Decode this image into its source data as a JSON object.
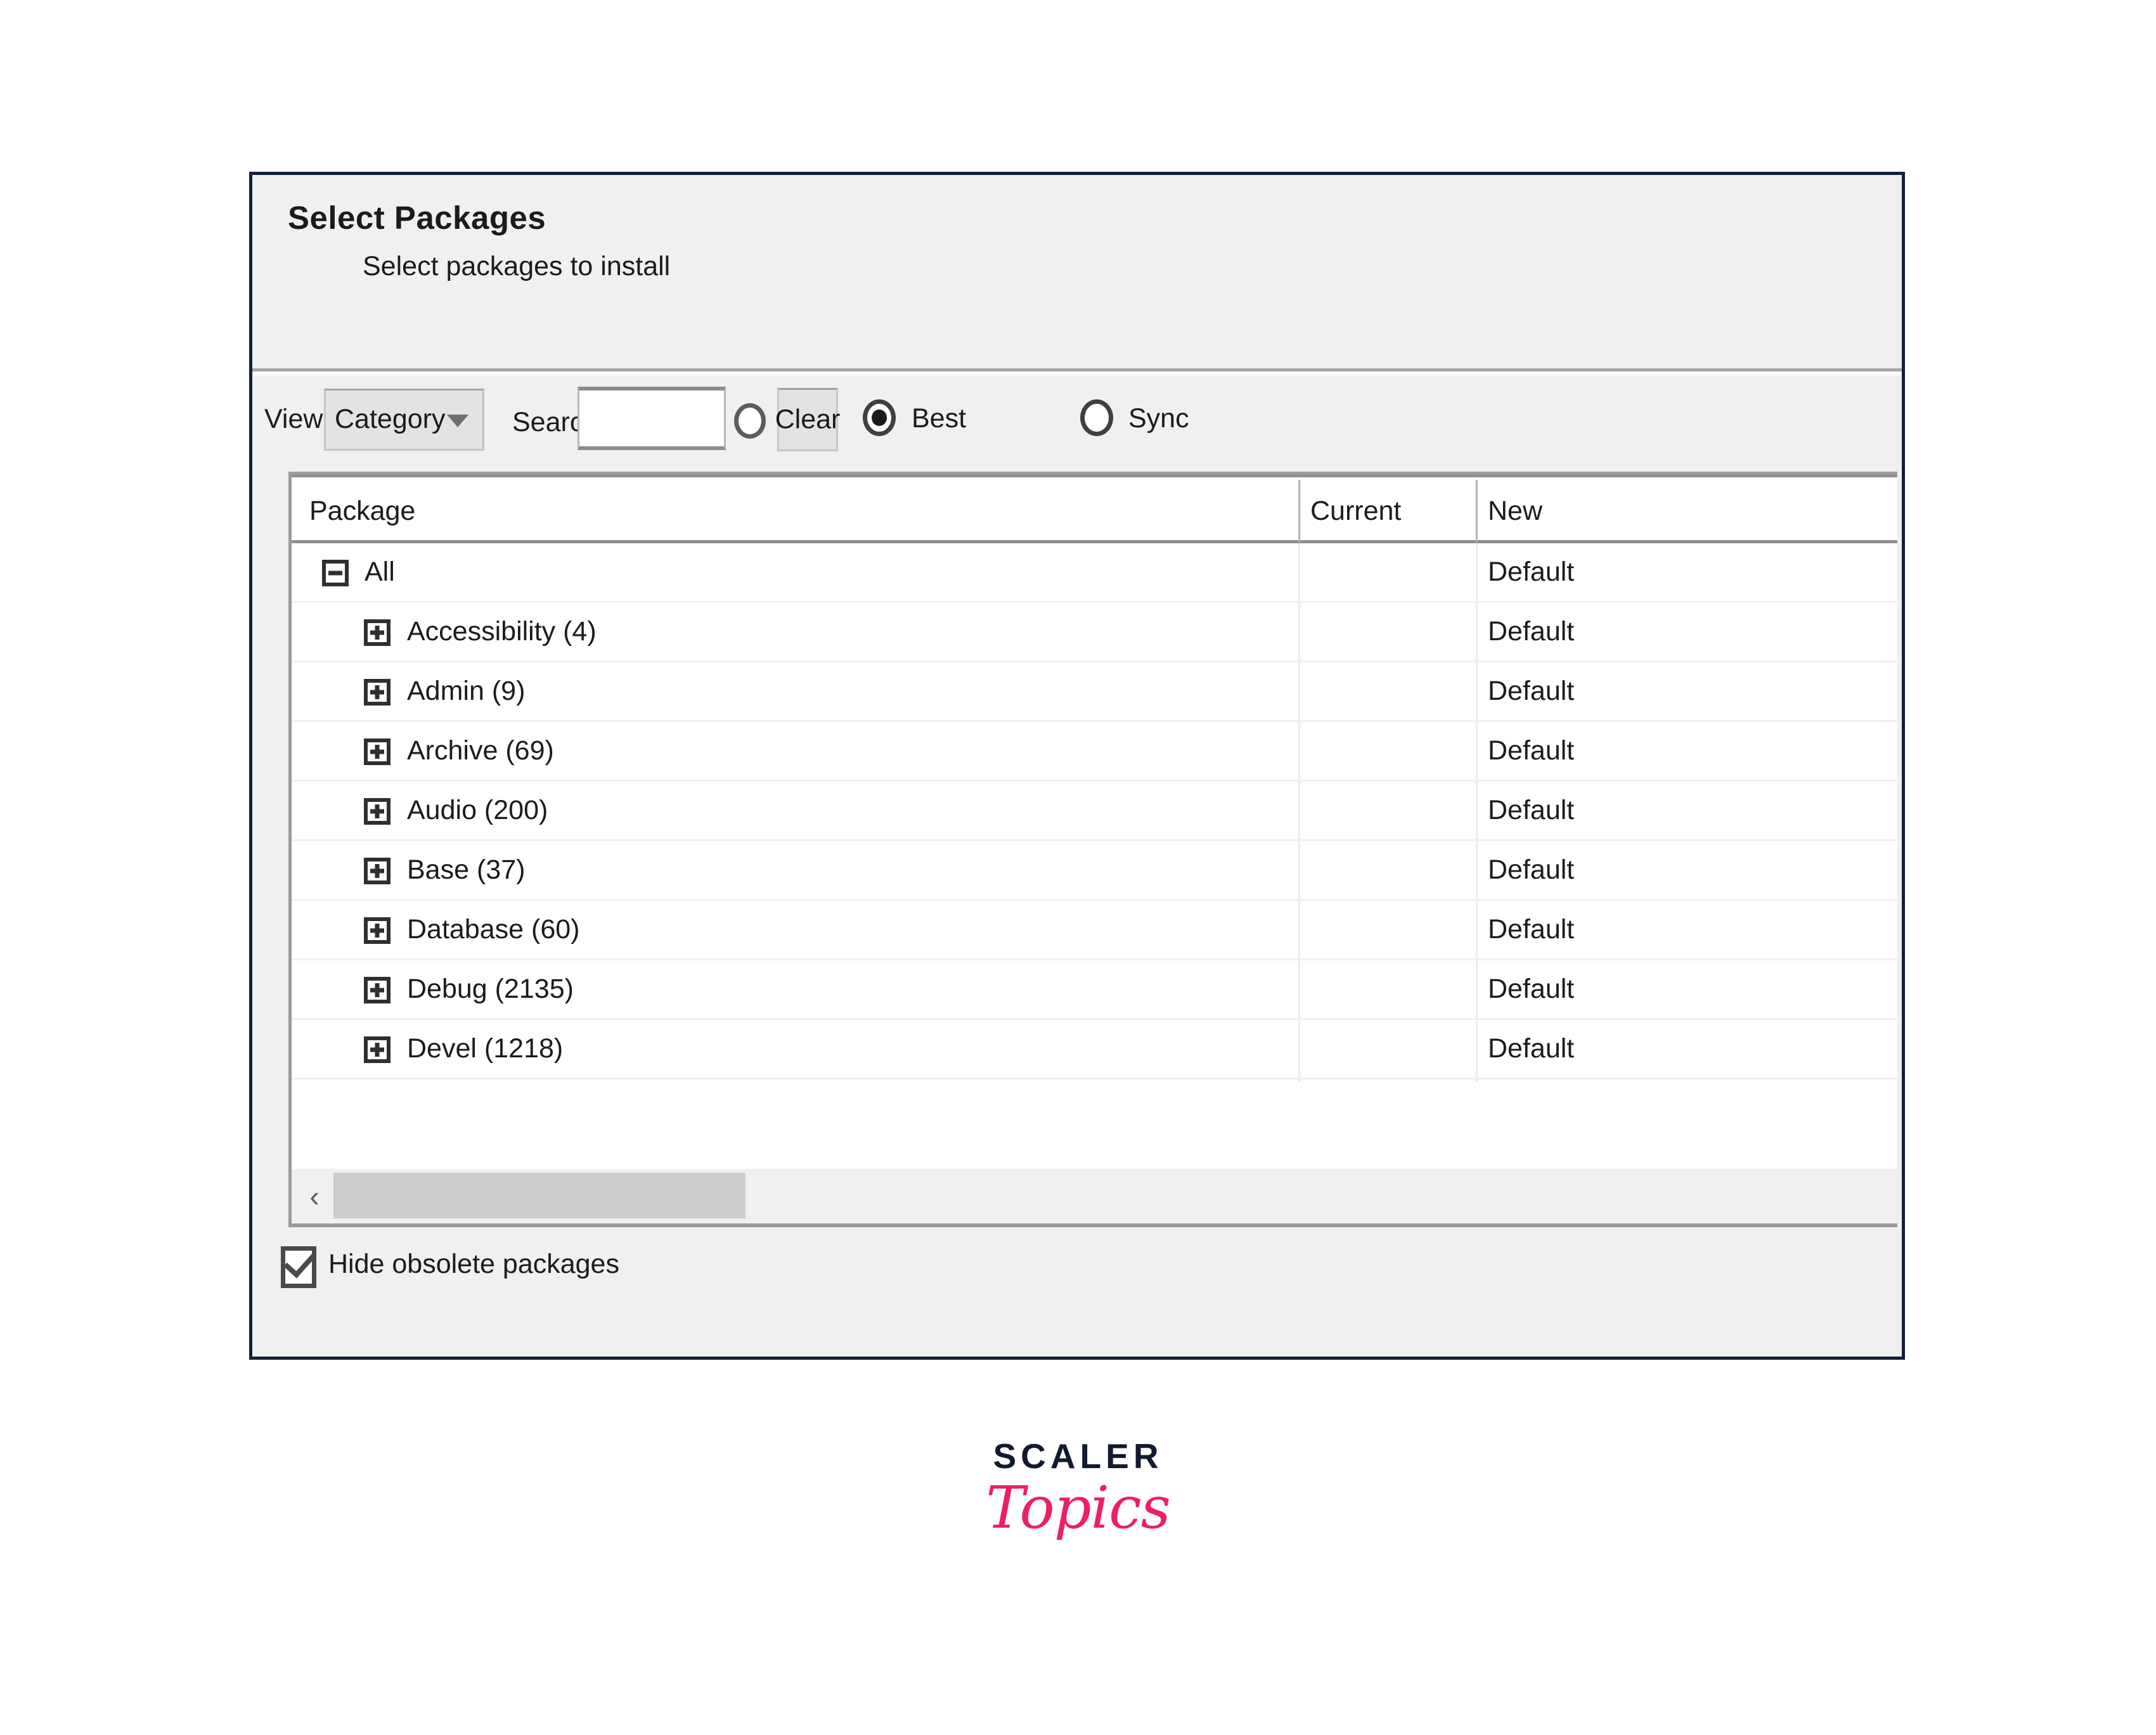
{
  "dialog": {
    "title": "Select Packages",
    "subtitle": "Select packages to install"
  },
  "toolbar": {
    "view_label": "View",
    "view_value": "Category",
    "view_options": [
      "Category"
    ],
    "search_label": "Search",
    "search_value": "",
    "search_placeholder": "",
    "clear_label": "Clear",
    "best_label": "Best",
    "best_selected": true,
    "sync_label": "Sync",
    "sync_selected": false
  },
  "table": {
    "columns": [
      "Package",
      "Current",
      "New"
    ],
    "rows": [
      {
        "label": "All",
        "current": "",
        "new": "Default",
        "depth": 0,
        "expander": "minus"
      },
      {
        "label": "Accessibility (4)",
        "current": "",
        "new": "Default",
        "depth": 1,
        "expander": "plus"
      },
      {
        "label": "Admin (9)",
        "current": "",
        "new": "Default",
        "depth": 1,
        "expander": "plus"
      },
      {
        "label": "Archive (69)",
        "current": "",
        "new": "Default",
        "depth": 1,
        "expander": "plus"
      },
      {
        "label": "Audio (200)",
        "current": "",
        "new": "Default",
        "depth": 1,
        "expander": "plus"
      },
      {
        "label": "Base (37)",
        "current": "",
        "new": "Default",
        "depth": 1,
        "expander": "plus"
      },
      {
        "label": "Database (60)",
        "current": "",
        "new": "Default",
        "depth": 1,
        "expander": "plus"
      },
      {
        "label": "Debug (2135)",
        "current": "",
        "new": "Default",
        "depth": 1,
        "expander": "plus"
      },
      {
        "label": "Devel (1218)",
        "current": "",
        "new": "Default",
        "depth": 1,
        "expander": "plus"
      }
    ]
  },
  "scrollbar": {
    "left_arrow": "‹"
  },
  "footer": {
    "hide_obsolete_label": "Hide obsolete packages",
    "hide_obsolete_checked": true
  },
  "watermark": {
    "brand": "SCALER",
    "sub": "Topics",
    "brand_color": "#111a2e",
    "sub_color": "#ec1f65"
  }
}
